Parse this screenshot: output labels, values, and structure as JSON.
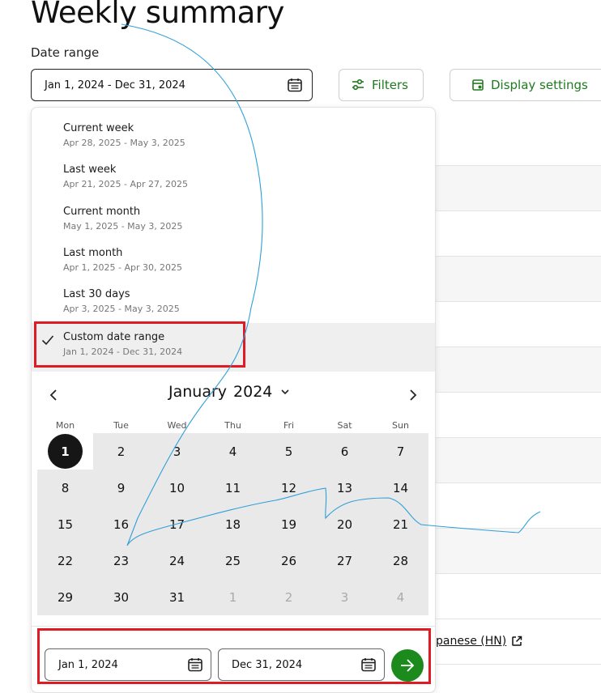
{
  "page": {
    "title": "Weekly summary"
  },
  "date_range": {
    "label": "Date range",
    "value": "Jan 1, 2024 - Dec 31, 2024"
  },
  "toolbar": {
    "filters_label": "Filters",
    "display_settings_label": "Display settings"
  },
  "presets": [
    {
      "label": "Current week",
      "range": "Apr 28, 2025 - May 3, 2025",
      "selected": false
    },
    {
      "label": "Last week",
      "range": "Apr 21, 2025 - Apr 27, 2025",
      "selected": false
    },
    {
      "label": "Current month",
      "range": "May 1, 2025 - May 3, 2025",
      "selected": false
    },
    {
      "label": "Last month",
      "range": "Apr 1, 2025 - Apr 30, 2025",
      "selected": false
    },
    {
      "label": "Last 30 days",
      "range": "Apr 3, 2025 - May 3, 2025",
      "selected": false
    },
    {
      "label": "Custom date range",
      "range": "Jan 1, 2024 - Dec 31, 2024",
      "selected": true
    }
  ],
  "calendar": {
    "month": "January",
    "year": "2024",
    "weekdays": [
      "Mon",
      "Tue",
      "Wed",
      "Thu",
      "Fri",
      "Sat",
      "Sun"
    ],
    "weeks": [
      [
        "1",
        "2",
        "3",
        "4",
        "5",
        "6",
        "7"
      ],
      [
        "8",
        "9",
        "10",
        "11",
        "12",
        "13",
        "14"
      ],
      [
        "15",
        "16",
        "17",
        "18",
        "19",
        "20",
        "21"
      ],
      [
        "22",
        "23",
        "24",
        "25",
        "26",
        "27",
        "28"
      ],
      [
        "29",
        "30",
        "31",
        "1",
        "2",
        "3",
        "4"
      ]
    ]
  },
  "inputs": {
    "start": "Jan 1, 2024",
    "end": "Dec 31, 2024"
  },
  "background": {
    "link_text": "panese (HN)"
  },
  "colors": {
    "accent": "#1c8a1c",
    "highlight": "#e01b24",
    "selected_day": "#161616",
    "range_fill": "#e9e9e9"
  }
}
